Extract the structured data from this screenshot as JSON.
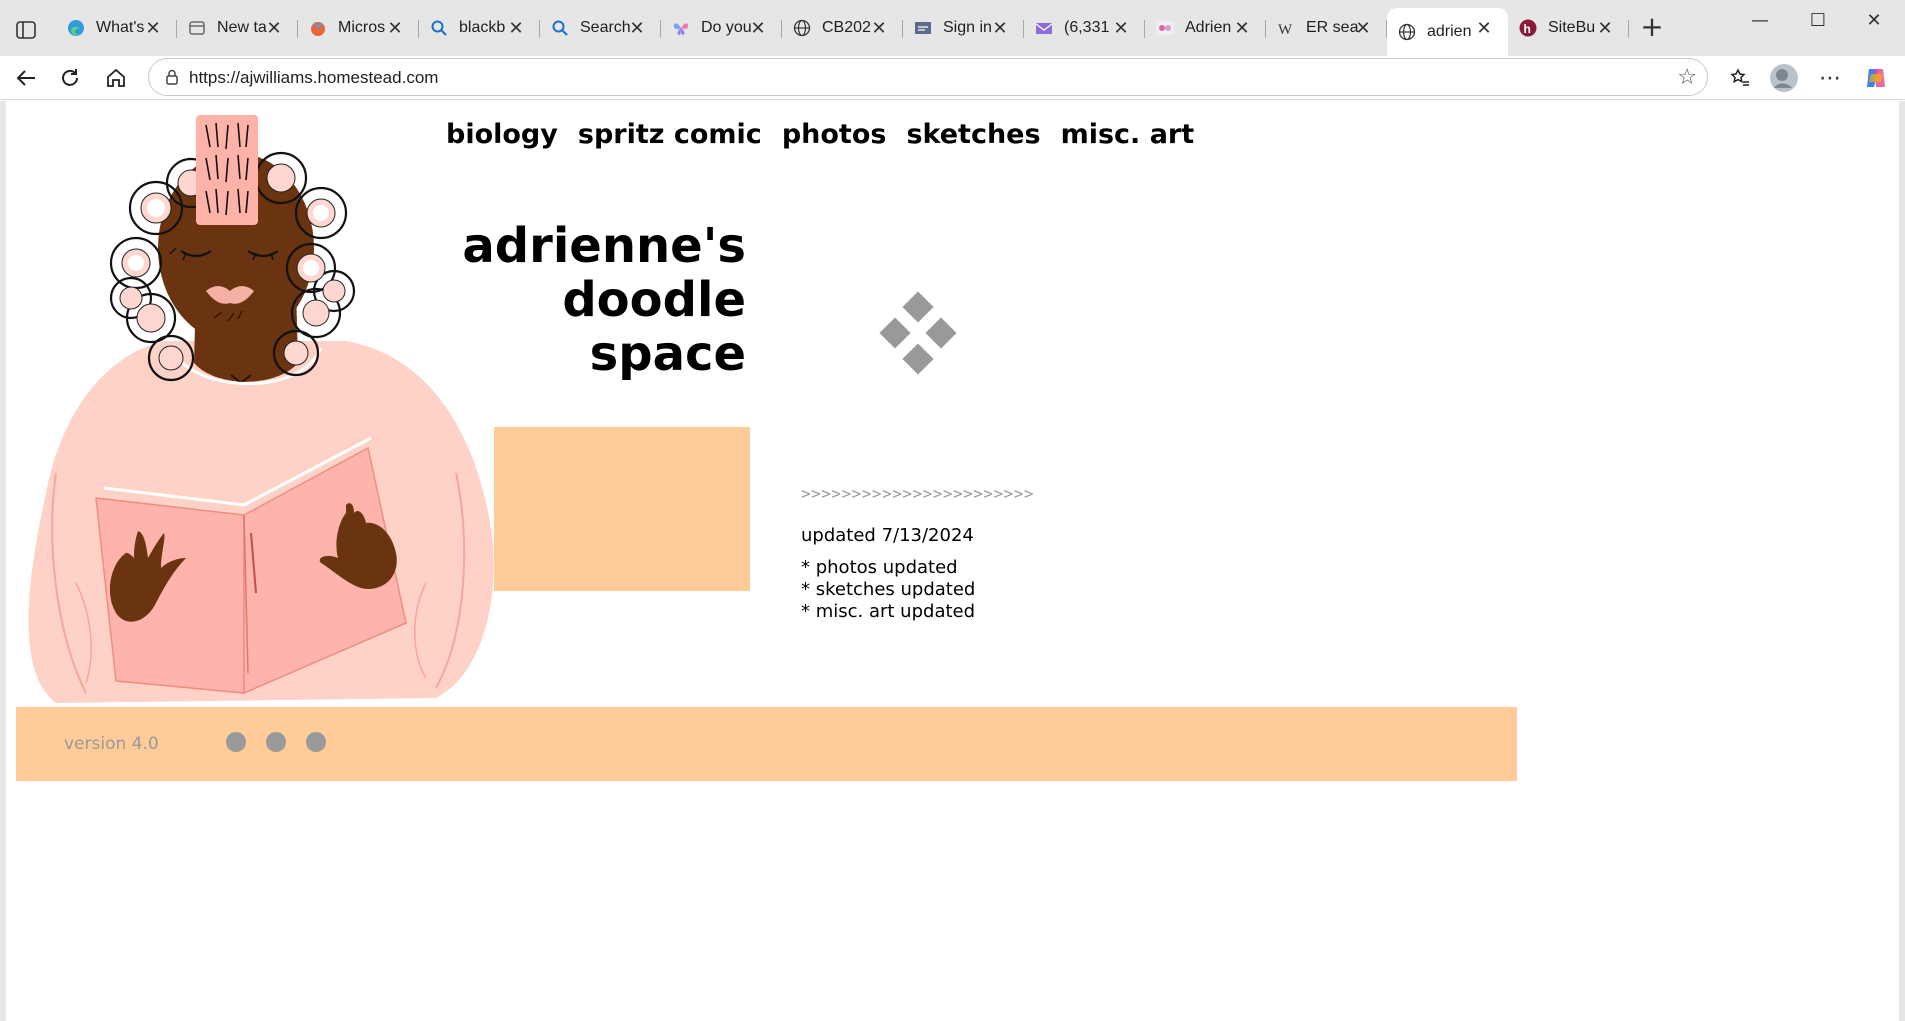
{
  "browser": {
    "tabs": [
      {
        "title": "What's",
        "icon": "edge-icon"
      },
      {
        "title": "New ta",
        "icon": "newtab-icon"
      },
      {
        "title": "Micros",
        "icon": "microsoft-start-icon"
      },
      {
        "title": "blackb",
        "icon": "search-icon"
      },
      {
        "title": "Search",
        "icon": "search-icon"
      },
      {
        "title": "Do you",
        "icon": "butterfly-icon"
      },
      {
        "title": "CB202",
        "icon": "globe-icon"
      },
      {
        "title": "Sign in",
        "icon": "signin-icon"
      },
      {
        "title": "(6,331",
        "icon": "mail-icon"
      },
      {
        "title": "Adrien",
        "icon": "flickr-icon"
      },
      {
        "title": "ER sea",
        "icon": "wikipedia-icon"
      },
      {
        "title": "adrien",
        "icon": "globe-icon",
        "active": true
      },
      {
        "title": "SiteBu",
        "icon": "sitebuilder-icon"
      }
    ],
    "url": "https://ajwilliams.homestead.com"
  },
  "site": {
    "nav": [
      "biology",
      "spritz comic",
      "photos",
      "sketches",
      "misc. art"
    ],
    "title_lines": [
      "adrienne's",
      "doodle",
      "space"
    ],
    "arrows": ">>>>>>>>>>>>>>>>>>>>>>>",
    "updated": "updated 7/13/2024",
    "changes": [
      "* photos updated",
      "* sketches updated",
      "* misc. art updated"
    ],
    "version": "version 4.0"
  },
  "colors": {
    "peach": "#ffcc99",
    "gray_ornament": "#999999",
    "skin": "#6b3410",
    "robe": "#ffc7bd"
  }
}
